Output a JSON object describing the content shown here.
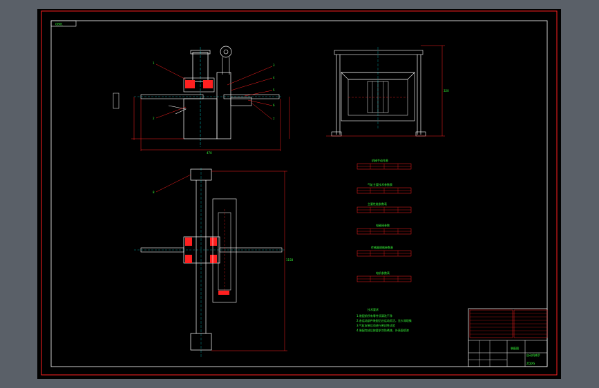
{
  "sheet": {
    "tag": "GB01",
    "title_block_name": "装配图",
    "title_block_product": "自动机械手",
    "drawing_number": "ZDJXS",
    "notes_title": "技术要求",
    "notes": [
      "1.装配前所有零件须清洗干净",
      "2.各运动部件装配后应运动灵活，无卡滞现象",
      "3.气缸安装后须进行密封性试验",
      "4.装配完成后按要求涂防锈漆，外表面喷漆"
    ],
    "tables": [
      {
        "title": "机械手动作表"
      },
      {
        "title": "气缸主要技术参数表"
      },
      {
        "title": "主要性能参数表"
      },
      {
        "title": "电磁阀参数"
      },
      {
        "title": "传感器规格参数表"
      },
      {
        "title": "电机参数表"
      }
    ],
    "callouts": [
      "1",
      "2",
      "3",
      "4",
      "5",
      "6",
      "7",
      "8"
    ],
    "dimensions": [
      "470",
      "320",
      "1158"
    ],
    "colors": {
      "background": "#000000",
      "frame": "#ff2020",
      "text": "#39ff3a",
      "lines": "#ffffff",
      "hatch": "#ff2020",
      "accent": "#00ffff"
    }
  }
}
